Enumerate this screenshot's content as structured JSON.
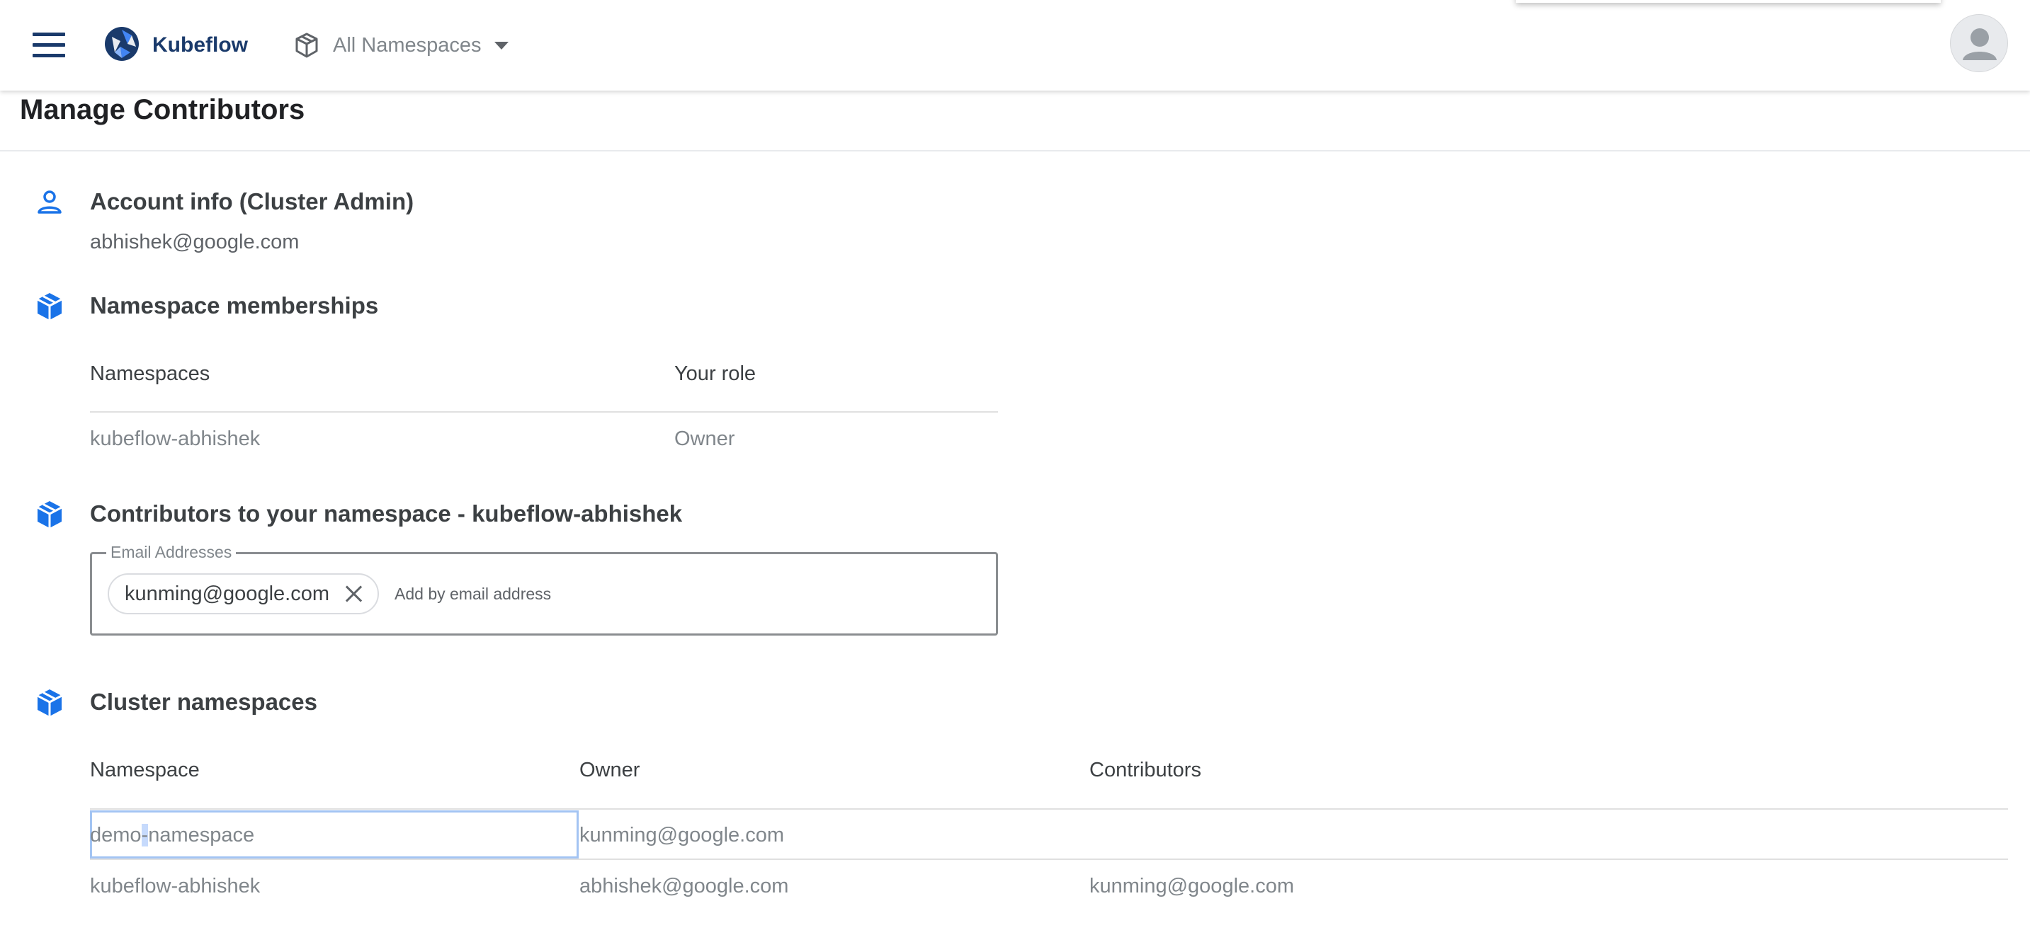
{
  "app": {
    "brand": "Kubeflow",
    "namespace_selector": "All Namespaces"
  },
  "page": {
    "title": "Manage Contributors"
  },
  "account": {
    "heading": "Account info  (Cluster Admin)",
    "email": "abhishek@google.com"
  },
  "memberships": {
    "heading": "Namespace memberships",
    "columns": [
      "Namespaces",
      "Your role"
    ],
    "rows": [
      {
        "namespace": "kubeflow-abhishek",
        "role": "Owner"
      }
    ]
  },
  "contributors": {
    "heading": "Contributors to your namespace - kubeflow-abhishek",
    "field_label": "Email Addresses",
    "chips": [
      "kunming@google.com"
    ],
    "placeholder": "Add by email address"
  },
  "cluster": {
    "heading": "Cluster namespaces",
    "columns": [
      "Namespace",
      "Owner",
      "Contributors"
    ],
    "rows": [
      {
        "namespace_a": "demo",
        "namespace_sel": "-",
        "namespace_b": "namespace",
        "owner": "kunming@google.com",
        "contributors": ""
      },
      {
        "namespace": "kubeflow-abhishek",
        "owner": "abhishek@google.com",
        "contributors": "kunming@google.com"
      }
    ]
  },
  "colors": {
    "accent": "#1a73e8",
    "brand": "#1a3a6b",
    "selection": "#a3c4f3"
  },
  "icons": [
    "menu-icon",
    "kubeflow-logo-icon",
    "namespace-cube-icon",
    "dropdown-caret-icon",
    "user-avatar-icon",
    "person-icon",
    "box-icon",
    "close-icon"
  ]
}
